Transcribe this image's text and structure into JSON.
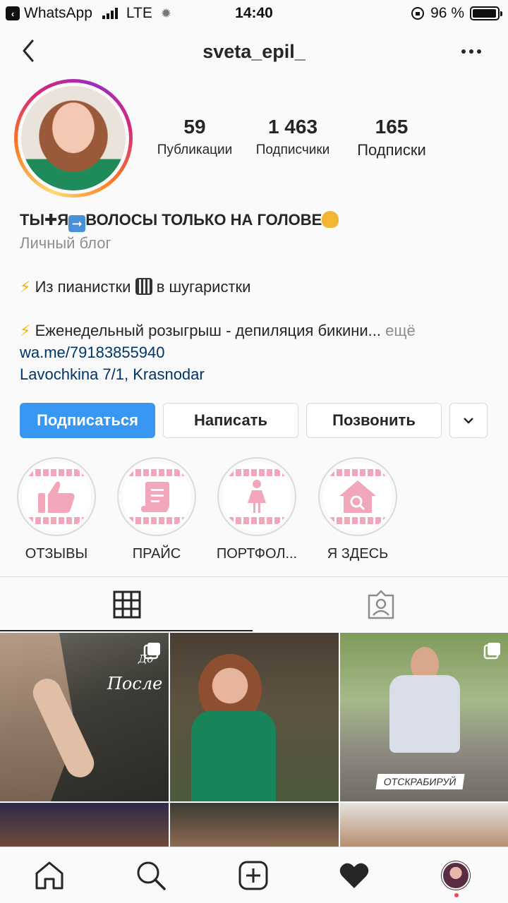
{
  "status_bar": {
    "back_app": "WhatsApp",
    "network": "LTE",
    "time": "14:40",
    "battery": "96 %",
    "battery_level": 0.96
  },
  "header": {
    "username": "sveta_epil_"
  },
  "profile": {
    "stats": [
      {
        "value": "59",
        "label": "Публикации"
      },
      {
        "value": "1 463",
        "label": "Подписчики"
      },
      {
        "value": "165",
        "label": "Подписки"
      }
    ],
    "bio": {
      "name_part1": "ТЫ",
      "name_part2": "Я",
      "name_part3": "ВОЛОСЫ ТОЛЬКО НА ГОЛОВЕ",
      "category": "Личный блог",
      "line1_a": "Из пианистки",
      "line1_b": "в шугаристки",
      "line2": "Еженедельный розыгрыш - депиляция бикини...",
      "more": "ещё",
      "link": "wa.me/79183855940",
      "address": "Lavochkina 7/1, Krasnodar"
    }
  },
  "actions": {
    "follow": "Подписаться",
    "message": "Написать",
    "call": "Позвонить"
  },
  "highlights": [
    {
      "label": "ОТЗЫВЫ",
      "icon": "thumbs-up-icon"
    },
    {
      "label": "ПРАЙС",
      "icon": "scroll-icon"
    },
    {
      "label": "ПОРТФОЛ...",
      "icon": "woman-icon"
    },
    {
      "label": "Я ЗДЕСЬ",
      "icon": "house-search-icon"
    }
  ],
  "posts": {
    "post1_caption_top": "До",
    "post1_caption": "После",
    "post3_tag": "ОТСКРАБИРУЙ"
  },
  "colors": {
    "accent": "#3897f0",
    "link": "#003569",
    "highlight_pink": "#f2a6b9"
  }
}
